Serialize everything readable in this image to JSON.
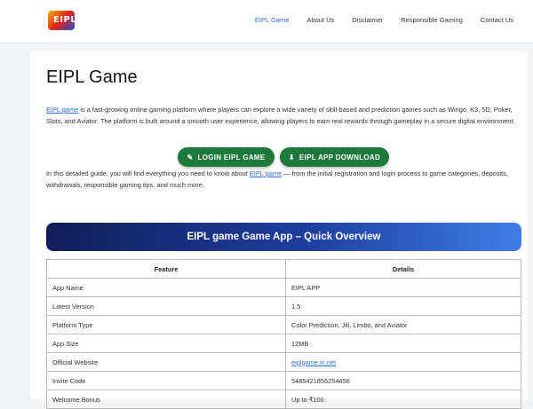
{
  "header": {
    "logo_text": "EIPL",
    "nav": [
      {
        "label": "EIPL Game",
        "active": true
      },
      {
        "label": "About Us"
      },
      {
        "label": "Disclaimer"
      },
      {
        "label": "Responsible Gaming"
      },
      {
        "label": "Contact Us"
      }
    ]
  },
  "main": {
    "title": "EIPL Game",
    "intro": {
      "link": "EIPL game",
      "text": " is a fast-growing online gaming platform where players can explore a wide variety of skill-based and prediction games such as Wingo, K3, 5D, Poker, Slots, and Aviator. The platform is built around a smooth user experience, allowing players to earn real rewards through gameplay in a secure digital environment."
    },
    "buttons": {
      "login": "LOGIN EIPL GAME",
      "download": "EIPL APP DOWNLOAD"
    },
    "guide": {
      "before": "In this detailed guide, you will find everything you need to know about ",
      "link": "EIPL game",
      "after": " — from the initial registration and login process to game categories, deposits, withdrawals, responsible gaming tips, and much more."
    },
    "overview_title": "EIPL game Game App – Quick Overview",
    "table": {
      "headers": [
        "Feature",
        "Details"
      ],
      "rows": [
        {
          "feature": "App Name",
          "details": "EIPL APP"
        },
        {
          "feature": "Latest Version",
          "details": "1.5"
        },
        {
          "feature": "Platform Type",
          "details": "Color Prediction, Jili, Limbo, and Aviator"
        },
        {
          "feature": "App Size",
          "details": "12MB"
        },
        {
          "feature": "Official Website",
          "details": "eiplgame.in.net",
          "link": true
        },
        {
          "feature": "Invite Code",
          "details": "5485421856254456"
        },
        {
          "feature": "Welcome Bonus",
          "details": "Up to ₹100"
        }
      ]
    }
  }
}
